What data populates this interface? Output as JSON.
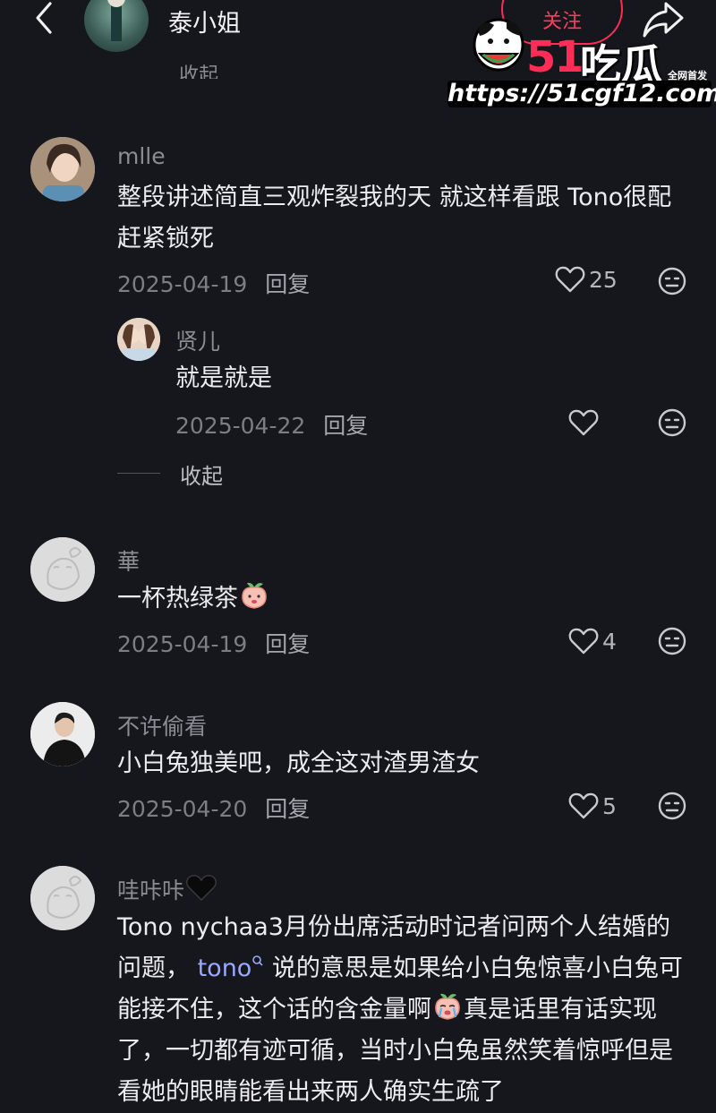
{
  "header": {
    "profile_name": "泰小姐",
    "follow_label": "关注"
  },
  "watermark": {
    "logo_51": "51",
    "logo_chigua": "吃瓜",
    "tag": "全网首发",
    "url": "https://51cgf12.com"
  },
  "partial_collapse": "收起",
  "comments": [
    {
      "username": "mlle",
      "text": "整段讲述简直三观炸裂我的天 就这样看跟 Tono很配 赶紧锁死",
      "date": "2025-04-19",
      "reply_label": "回复",
      "likes": "25",
      "reply": {
        "username": "贤儿",
        "text": "就是就是",
        "date": "2025-04-22",
        "reply_label": "回复",
        "likes": ""
      }
    },
    {
      "username": "華",
      "text": "一杯热绿茶",
      "date": "2025-04-19",
      "reply_label": "回复",
      "likes": "4"
    },
    {
      "username": "不许偷看",
      "text": "小白兔独美吧，成全这对渣男渣女",
      "date": "2025-04-20",
      "reply_label": "回复",
      "likes": "5"
    },
    {
      "username": "哇咔咔",
      "text_part1": "Tono nychaa3月份出席活动时记者问两个人结婚的问题， ",
      "mention": "tono",
      "text_part2": " 说的意思是如果给小白兔惊喜小白兔可能接不住，这个话的含金量啊",
      "text_part3": "真是话里有话实现了，一切都有迹可循，当时小白兔虽然笑着惊呼但是看她的眼睛能看出来两人确实生疏了"
    }
  ],
  "collapse_label": "收起"
}
